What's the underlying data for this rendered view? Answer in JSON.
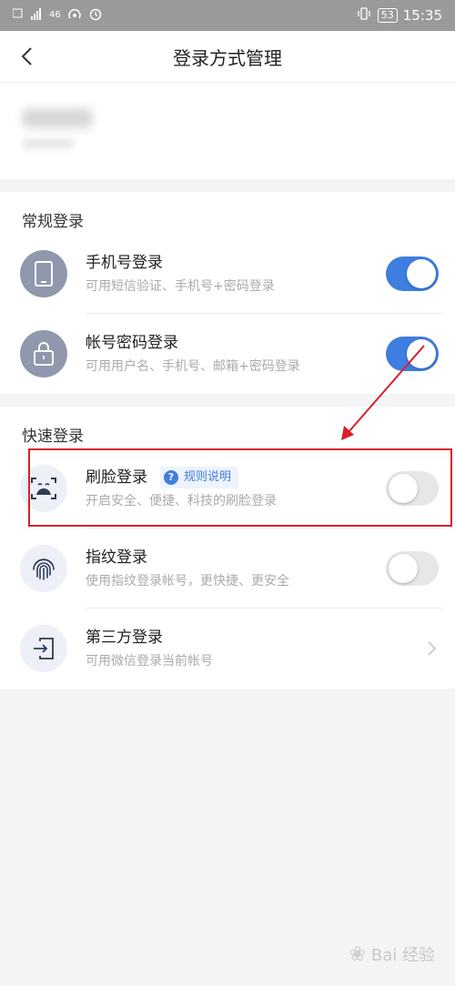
{
  "statusbar": {
    "signal_small_top": "46",
    "time": "15:35",
    "battery": "53"
  },
  "header": {
    "title": "登录方式管理"
  },
  "sections": {
    "regular": {
      "title": "常规登录",
      "items": [
        {
          "title": "手机号登录",
          "subtitle": "可用短信验证、手机号+密码登录",
          "icon": "phone-icon",
          "enabled": true
        },
        {
          "title": "帐号密码登录",
          "subtitle": "可用用户名、手机号、邮箱+密码登录",
          "icon": "lock-icon",
          "enabled": true
        }
      ]
    },
    "quick": {
      "title": "快速登录",
      "items": [
        {
          "title": "刷脸登录",
          "subtitle": "开启安全、便捷、科技的刷脸登录",
          "icon": "face-scan-icon",
          "enabled": false,
          "badge": "规则说明",
          "badge_icon": "?"
        },
        {
          "title": "指纹登录",
          "subtitle": "使用指纹登录帐号，更快捷、更安全",
          "icon": "fingerprint-icon",
          "enabled": false
        },
        {
          "title": "第三方登录",
          "subtitle": "可用微信登录当前帐号",
          "icon": "login-arrow-icon",
          "chevron": true
        }
      ]
    }
  },
  "colors": {
    "accent": "#3e7ee0",
    "annotation_red": "#d92028"
  },
  "watermark": {
    "text": "Bai  经验"
  }
}
